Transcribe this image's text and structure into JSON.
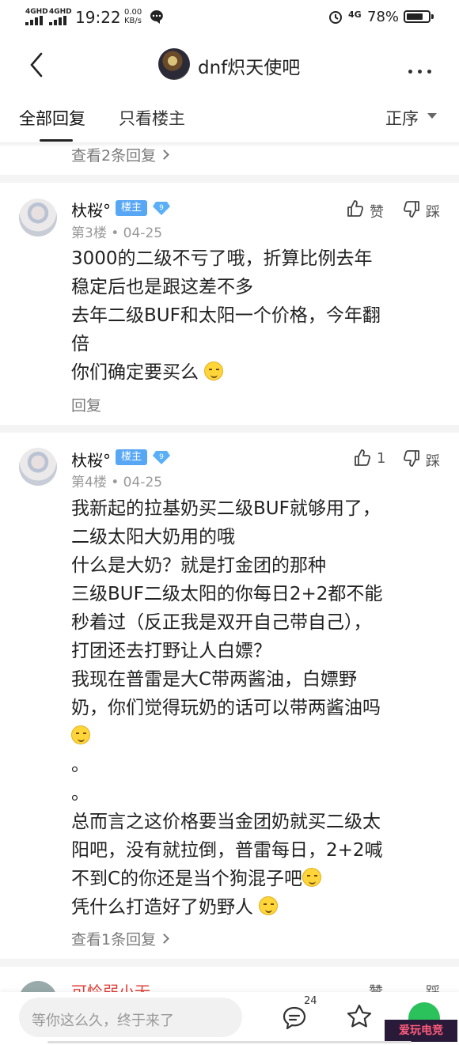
{
  "status_bar": {
    "net1": "4GHD",
    "net2": "4GHD",
    "time": "19:22",
    "speed_value": "0.00",
    "speed_unit": "KB/s",
    "network": "4G",
    "battery": "78%",
    "battery_level": 0.78
  },
  "nav": {
    "title": "dnf炽天使吧"
  },
  "tabs": {
    "all": "全部回复",
    "owner_only": "只看楼主",
    "order": "正序"
  },
  "top_reply_link": "查看2条回复",
  "posts": [
    {
      "username": "杕桜°",
      "badge": "楼主",
      "level": "9",
      "floor": "第3楼",
      "date": "04-25",
      "like_label": "赞",
      "dislike_label": "踩",
      "lines": [
        "3000的二级不亏了哦，折算比例去年",
        "稳定后也是跟这差不多",
        "去年二级BUF和太阳一个价格，今年翻",
        "倍",
        "你们确定要买么"
      ],
      "reply_label": "回复"
    },
    {
      "username": "杕桜°",
      "badge": "楼主",
      "level": "9",
      "floor": "第4楼",
      "date": "04-25",
      "like_count": "1",
      "dislike_label": "踩",
      "lines": [
        "我新起的拉基奶买二级BUF就够用了，",
        "二级太阳大奶用的哦",
        "什么是大奶？就是打金团的那种",
        "三级BUF二级太阳的你每日2+2都不能",
        "秒着过（反正我是双开自己带自己），",
        "打团还去打野让人白嫖？",
        "我现在普雷是大C带两酱油，白嫖野",
        "奶，你们觉得玩奶的话可以带两酱油吗",
        "",
        "。",
        "。",
        "总而言之这价格要当金团奶就买二级太",
        "阳吧，没有就拉倒，普雷每日，2+2喊",
        "不到C的你还是当个狗混子吧",
        "凭什么打造好了奶野人"
      ],
      "reply_link": "查看1条回复"
    }
  ],
  "peek": {
    "username": "可怜弱小无",
    "like_label": "赞",
    "dislike_label": "踩"
  },
  "bottom": {
    "input_placeholder": "等你这么久，终于来了",
    "comment_count": "24",
    "watermark": "爱玩电竞"
  }
}
